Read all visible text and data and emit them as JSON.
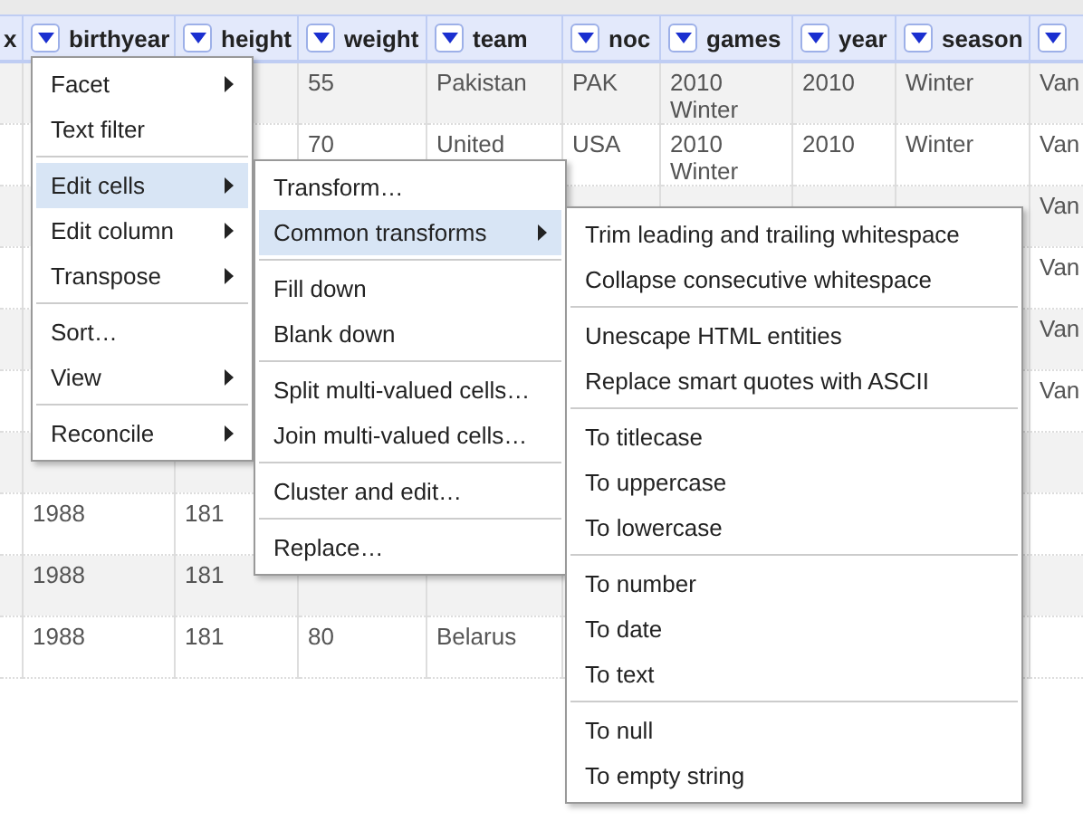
{
  "table": {
    "columns": [
      {
        "label": "x"
      },
      {
        "label": "birthyear"
      },
      {
        "label": "height"
      },
      {
        "label": "weight"
      },
      {
        "label": "team"
      },
      {
        "label": "noc"
      },
      {
        "label": "games"
      },
      {
        "label": "year"
      },
      {
        "label": "season"
      },
      {}
    ],
    "rows": [
      {
        "cells": [
          "",
          "",
          "",
          "55",
          "Pakistan",
          "PAK",
          "2010 Winter",
          "2010",
          "Winter",
          "Van"
        ]
      },
      {
        "cells": [
          "",
          "",
          "",
          "70",
          "United",
          "USA",
          "2010 Winter",
          "2010",
          "Winter",
          "Van"
        ]
      },
      {
        "cells": [
          "",
          "",
          "",
          "",
          "",
          "",
          "",
          "",
          "",
          "Van"
        ]
      },
      {
        "cells": [
          "",
          "",
          "",
          "",
          "",
          "",
          "",
          "",
          "",
          "Van"
        ]
      },
      {
        "cells": [
          "",
          "",
          "",
          "",
          "",
          "",
          "",
          "",
          "",
          "Van"
        ]
      },
      {
        "cells": [
          "",
          "",
          "",
          "",
          "",
          "",
          "",
          "",
          "",
          "Van"
        ]
      },
      {
        "cells": [
          "",
          "",
          "",
          "",
          "",
          "",
          "",
          "",
          "",
          ""
        ]
      },
      {
        "cells": [
          "",
          "1988",
          "181",
          "",
          "",
          "",
          "",
          "",
          "",
          ""
        ]
      },
      {
        "cells": [
          "",
          "1988",
          "181",
          "",
          "",
          "",
          "",
          "",
          "",
          ""
        ]
      },
      {
        "cells": [
          "",
          "1988",
          "181",
          "80",
          "Belarus",
          "",
          "",
          "",
          "",
          ""
        ]
      }
    ]
  },
  "menus": [
    {
      "items": [
        {
          "kind": "item",
          "label": "Facet",
          "submenu": true,
          "selected": false
        },
        {
          "kind": "item",
          "label": "Text filter",
          "submenu": false,
          "selected": false
        },
        {
          "kind": "separator"
        },
        {
          "kind": "item",
          "label": "Edit cells",
          "submenu": true,
          "selected": true
        },
        {
          "kind": "item",
          "label": "Edit column",
          "submenu": true,
          "selected": false
        },
        {
          "kind": "item",
          "label": "Transpose",
          "submenu": true,
          "selected": false
        },
        {
          "kind": "separator"
        },
        {
          "kind": "item",
          "label": "Sort…",
          "submenu": false,
          "selected": false
        },
        {
          "kind": "item",
          "label": "View",
          "submenu": true,
          "selected": false
        },
        {
          "kind": "separator"
        },
        {
          "kind": "item",
          "label": "Reconcile",
          "submenu": true,
          "selected": false
        }
      ]
    },
    {
      "items": [
        {
          "kind": "item",
          "label": "Transform…",
          "submenu": false,
          "selected": false
        },
        {
          "kind": "item",
          "label": "Common transforms",
          "submenu": true,
          "selected": true
        },
        {
          "kind": "separator"
        },
        {
          "kind": "item",
          "label": "Fill down",
          "submenu": false,
          "selected": false
        },
        {
          "kind": "item",
          "label": "Blank down",
          "submenu": false,
          "selected": false
        },
        {
          "kind": "separator"
        },
        {
          "kind": "item",
          "label": "Split multi-valued cells…",
          "submenu": false,
          "selected": false
        },
        {
          "kind": "item",
          "label": "Join multi-valued cells…",
          "submenu": false,
          "selected": false
        },
        {
          "kind": "separator"
        },
        {
          "kind": "item",
          "label": "Cluster and edit…",
          "submenu": false,
          "selected": false
        },
        {
          "kind": "separator"
        },
        {
          "kind": "item",
          "label": "Replace…",
          "submenu": false,
          "selected": false
        }
      ]
    },
    {
      "items": [
        {
          "kind": "item",
          "label": "Trim leading and trailing whitespace",
          "submenu": false,
          "selected": false
        },
        {
          "kind": "item",
          "label": "Collapse consecutive whitespace",
          "submenu": false,
          "selected": false
        },
        {
          "kind": "separator"
        },
        {
          "kind": "item",
          "label": "Unescape HTML entities",
          "submenu": false,
          "selected": false
        },
        {
          "kind": "item",
          "label": "Replace smart quotes with ASCII",
          "submenu": false,
          "selected": false
        },
        {
          "kind": "separator"
        },
        {
          "kind": "item",
          "label": "To titlecase",
          "submenu": false,
          "selected": false
        },
        {
          "kind": "item",
          "label": "To uppercase",
          "submenu": false,
          "selected": false
        },
        {
          "kind": "item",
          "label": "To lowercase",
          "submenu": false,
          "selected": false
        },
        {
          "kind": "separator"
        },
        {
          "kind": "item",
          "label": "To number",
          "submenu": false,
          "selected": false
        },
        {
          "kind": "item",
          "label": "To date",
          "submenu": false,
          "selected": false
        },
        {
          "kind": "item",
          "label": "To text",
          "submenu": false,
          "selected": false
        },
        {
          "kind": "separator"
        },
        {
          "kind": "item",
          "label": "To null",
          "submenu": false,
          "selected": false
        },
        {
          "kind": "item",
          "label": "To empty string",
          "submenu": false,
          "selected": false
        }
      ]
    }
  ]
}
